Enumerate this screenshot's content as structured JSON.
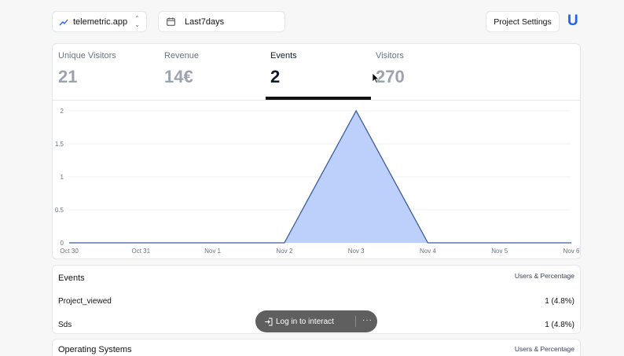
{
  "header": {
    "site": "telemetric.app",
    "date_range": "Last7days",
    "settings_label": "Project Settings",
    "logo_text": "U",
    "accent": "#2563eb"
  },
  "stats": [
    {
      "label": "Unique Visitors",
      "value": "21"
    },
    {
      "label": "Revenue",
      "value": "14€"
    },
    {
      "label": "Events",
      "value": "2",
      "active": true
    },
    {
      "label": "Visitors",
      "value": "270"
    }
  ],
  "chart_data": {
    "type": "area",
    "x": [
      "Oct 30",
      "Oct 31",
      "Nov 1",
      "Nov 2",
      "Nov 3",
      "Nov 4",
      "Nov 5",
      "Nov 6"
    ],
    "values": [
      0,
      0,
      0,
      0,
      2,
      0,
      0,
      0
    ],
    "yticks": [
      "0",
      "0.5",
      "1",
      "1.5",
      "2"
    ],
    "ylim": [
      0,
      2
    ],
    "grid": true,
    "fill": "#bcd0fb",
    "stroke": "#3b5b9a"
  },
  "events_list": {
    "title": "Events",
    "header_right": "Users & Percentage",
    "rows": [
      {
        "name": "Project_viewed",
        "value": "1 (4.8%)"
      },
      {
        "name": "Sds",
        "value": "1 (4.8%)"
      }
    ]
  },
  "os_list": {
    "title": "Operating Systems",
    "header_right": "Users & Percentage"
  },
  "toast": {
    "label": "Log in to interact",
    "more": "···"
  }
}
